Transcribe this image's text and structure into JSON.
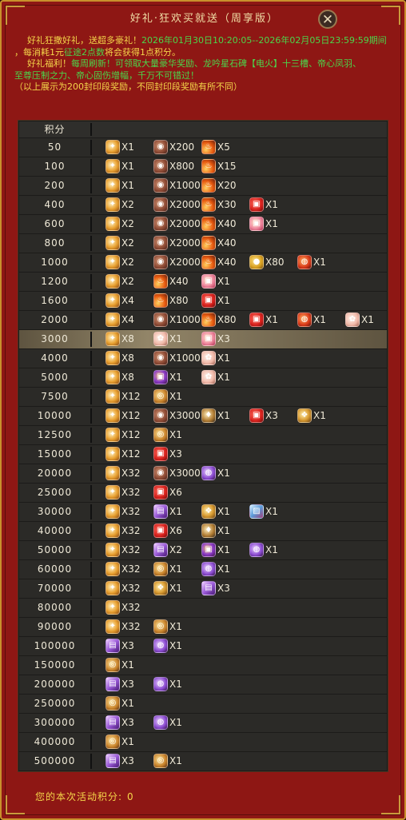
{
  "title": "好礼·狂欢买就送（周享版）",
  "close_label": "✕",
  "desc": {
    "line1_a": "好礼狂撒好礼，送超多豪礼！",
    "line1_b": "2026年01月30日10:20:05--2026年02月05日23:59:59期间",
    "line2_a": "，每消耗1元",
    "line2_b": "征途2点数",
    "line2_c": "将会获得1点积分。",
    "line3_a": "好礼福利！",
    "line3_b": "每周刷新！可领取大量豪华奖励、龙吟星石碑【电火】十三槽、帝心凤羽、",
    "line4": "至尊压制之力、帝心固伤增幅，千万不可错过！",
    "line5": "（以上展示为200封印段奖励，不同封印段奖励有所不同）"
  },
  "table": {
    "header_label": "积分",
    "rows": [
      {
        "score": "50",
        "rewards": [
          {
            "icon": "gift-box-icon",
            "qty": "X1"
          },
          {
            "icon": "stone-icon",
            "qty": "X200"
          },
          {
            "icon": "flame-feather-icon",
            "qty": "X5"
          }
        ]
      },
      {
        "score": "100",
        "rewards": [
          {
            "icon": "gift-box-icon",
            "qty": "X1"
          },
          {
            "icon": "stone-icon",
            "qty": "X800"
          },
          {
            "icon": "flame-feather-icon",
            "qty": "X15"
          }
        ]
      },
      {
        "score": "200",
        "rewards": [
          {
            "icon": "gift-box-icon",
            "qty": "X1"
          },
          {
            "icon": "stone-icon",
            "qty": "X1000"
          },
          {
            "icon": "flame-feather-icon",
            "qty": "X20"
          }
        ]
      },
      {
        "score": "400",
        "rewards": [
          {
            "icon": "gift-box-icon",
            "qty": "X2"
          },
          {
            "icon": "stone-icon",
            "qty": "X2000"
          },
          {
            "icon": "flame-feather-icon",
            "qty": "X30"
          },
          {
            "icon": "red-gift-icon",
            "qty": "X1"
          }
        ]
      },
      {
        "score": "600",
        "rewards": [
          {
            "icon": "gift-box-icon",
            "qty": "X2"
          },
          {
            "icon": "stone-icon",
            "qty": "X2000"
          },
          {
            "icon": "flame-feather-icon",
            "qty": "X40"
          },
          {
            "icon": "pink-gift-icon",
            "qty": "X1"
          }
        ]
      },
      {
        "score": "800",
        "rewards": [
          {
            "icon": "gift-box-icon",
            "qty": "X2"
          },
          {
            "icon": "stone-icon",
            "qty": "X2000"
          },
          {
            "icon": "flame-feather-icon",
            "qty": "X40"
          }
        ]
      },
      {
        "score": "1000",
        "rewards": [
          {
            "icon": "gift-box-icon",
            "qty": "X2"
          },
          {
            "icon": "stone-icon",
            "qty": "X2000"
          },
          {
            "icon": "flame-feather-icon",
            "qty": "X40"
          },
          {
            "icon": "gold-coin-icon",
            "qty": "X80"
          },
          {
            "icon": "fire-orb-icon",
            "qty": "X1"
          }
        ]
      },
      {
        "score": "1200",
        "rewards": [
          {
            "icon": "gift-box-icon",
            "qty": "X2"
          },
          {
            "icon": "flame-feather-icon",
            "qty": "X40"
          },
          {
            "icon": "pink-gift-icon",
            "qty": "X1"
          }
        ]
      },
      {
        "score": "1600",
        "rewards": [
          {
            "icon": "gift-box-icon",
            "qty": "X4"
          },
          {
            "icon": "flame-feather-icon",
            "qty": "X80"
          },
          {
            "icon": "red-gift-icon",
            "qty": "X1"
          }
        ]
      },
      {
        "score": "2000",
        "rewards": [
          {
            "icon": "gift-box-icon",
            "qty": "X4"
          },
          {
            "icon": "stone-icon",
            "qty": "X1000"
          },
          {
            "icon": "flame-feather-icon",
            "qty": "X80"
          },
          {
            "icon": "red-gift-icon",
            "qty": "X1"
          },
          {
            "icon": "fire-orb-icon",
            "qty": "X1"
          },
          {
            "icon": "petal-icon",
            "qty": "X1"
          }
        ]
      },
      {
        "score": "3000",
        "highlight": true,
        "rewards": [
          {
            "icon": "gift-box-icon",
            "qty": "X8"
          },
          {
            "icon": "petal-icon",
            "qty": "X1"
          },
          {
            "icon": "pink-gift-icon",
            "qty": "X3"
          }
        ]
      },
      {
        "score": "4000",
        "rewards": [
          {
            "icon": "gift-box-icon",
            "qty": "X8"
          },
          {
            "icon": "stone-icon",
            "qty": "X1000"
          },
          {
            "icon": "petal-icon",
            "qty": "X1"
          }
        ]
      },
      {
        "score": "5000",
        "rewards": [
          {
            "icon": "gift-box-icon",
            "qty": "X8"
          },
          {
            "icon": "purple-gift-icon",
            "qty": "X1"
          },
          {
            "icon": "petal-icon",
            "qty": "X1"
          }
        ]
      },
      {
        "score": "7500",
        "rewards": [
          {
            "icon": "gift-box-icon",
            "qty": "X12"
          },
          {
            "icon": "gold-medal-icon",
            "qty": "X1"
          }
        ]
      },
      {
        "score": "10000",
        "rewards": [
          {
            "icon": "gift-box-icon",
            "qty": "X12"
          },
          {
            "icon": "stone-icon",
            "qty": "X3000"
          },
          {
            "icon": "crystal-shard-icon",
            "qty": "X1"
          },
          {
            "icon": "red-gift-icon",
            "qty": "X3"
          },
          {
            "icon": "emblem-icon",
            "qty": "X1"
          }
        ]
      },
      {
        "score": "12500",
        "rewards": [
          {
            "icon": "gift-box-icon",
            "qty": "X12"
          },
          {
            "icon": "gold-medal-icon",
            "qty": "X1"
          }
        ]
      },
      {
        "score": "15000",
        "rewards": [
          {
            "icon": "gift-box-icon",
            "qty": "X12"
          },
          {
            "icon": "red-gift-icon",
            "qty": "X3"
          }
        ]
      },
      {
        "score": "20000",
        "rewards": [
          {
            "icon": "gift-box-icon",
            "qty": "X32"
          },
          {
            "icon": "stone-icon",
            "qty": "X3000"
          },
          {
            "icon": "purple-orb-icon",
            "qty": "X1"
          }
        ]
      },
      {
        "score": "25000",
        "rewards": [
          {
            "icon": "gift-box-icon",
            "qty": "X32"
          },
          {
            "icon": "red-gift-icon",
            "qty": "X6"
          }
        ]
      },
      {
        "score": "30000",
        "rewards": [
          {
            "icon": "gift-box-icon",
            "qty": "X32"
          },
          {
            "icon": "purple-scroll-icon",
            "qty": "X1"
          },
          {
            "icon": "emblem-icon",
            "qty": "X1"
          },
          {
            "icon": "blue-card-icon",
            "qty": "X1"
          }
        ]
      },
      {
        "score": "40000",
        "rewards": [
          {
            "icon": "gift-box-icon",
            "qty": "X32"
          },
          {
            "icon": "red-gift-icon",
            "qty": "X6"
          },
          {
            "icon": "crystal-shard-icon",
            "qty": "X1"
          }
        ]
      },
      {
        "score": "50000",
        "rewards": [
          {
            "icon": "gift-box-icon",
            "qty": "X32"
          },
          {
            "icon": "purple-scroll-icon",
            "qty": "X2"
          },
          {
            "icon": "purple-gift-icon",
            "qty": "X1"
          },
          {
            "icon": "purple-orb-icon",
            "qty": "X1"
          }
        ]
      },
      {
        "score": "60000",
        "rewards": [
          {
            "icon": "gift-box-icon",
            "qty": "X32"
          },
          {
            "icon": "gold-medal-icon",
            "qty": "X1"
          },
          {
            "icon": "purple-orb-icon",
            "qty": "X1"
          }
        ]
      },
      {
        "score": "70000",
        "rewards": [
          {
            "icon": "gift-box-icon",
            "qty": "X32"
          },
          {
            "icon": "emblem-icon",
            "qty": "X1"
          },
          {
            "icon": "purple-scroll-icon",
            "qty": "X3"
          }
        ]
      },
      {
        "score": "80000",
        "rewards": [
          {
            "icon": "gift-box-icon",
            "qty": "X32"
          }
        ]
      },
      {
        "score": "90000",
        "rewards": [
          {
            "icon": "gift-box-icon",
            "qty": "X32"
          },
          {
            "icon": "gold-medal-icon",
            "qty": "X1"
          }
        ]
      },
      {
        "score": "100000",
        "rewards": [
          {
            "icon": "purple-scroll-icon",
            "qty": "X3"
          },
          {
            "icon": "purple-orb-icon",
            "qty": "X1"
          }
        ]
      },
      {
        "score": "150000",
        "rewards": [
          {
            "icon": "gold-medal-icon",
            "qty": "X1"
          }
        ]
      },
      {
        "score": "200000",
        "rewards": [
          {
            "icon": "purple-scroll-icon",
            "qty": "X3"
          },
          {
            "icon": "purple-orb-icon",
            "qty": "X1"
          }
        ]
      },
      {
        "score": "250000",
        "rewards": [
          {
            "icon": "gold-medal-icon",
            "qty": "X1"
          }
        ]
      },
      {
        "score": "300000",
        "rewards": [
          {
            "icon": "purple-scroll-icon",
            "qty": "X3"
          },
          {
            "icon": "purple-orb-icon",
            "qty": "X1"
          }
        ]
      },
      {
        "score": "400000",
        "rewards": [
          {
            "icon": "gold-medal-icon",
            "qty": "X1"
          }
        ]
      },
      {
        "score": "500000",
        "rewards": [
          {
            "icon": "purple-scroll-icon",
            "qty": "X3"
          },
          {
            "icon": "gold-medal-icon",
            "qty": "X1"
          }
        ]
      }
    ]
  },
  "footer": {
    "label": "您的本次活动积分:",
    "value": "0"
  }
}
